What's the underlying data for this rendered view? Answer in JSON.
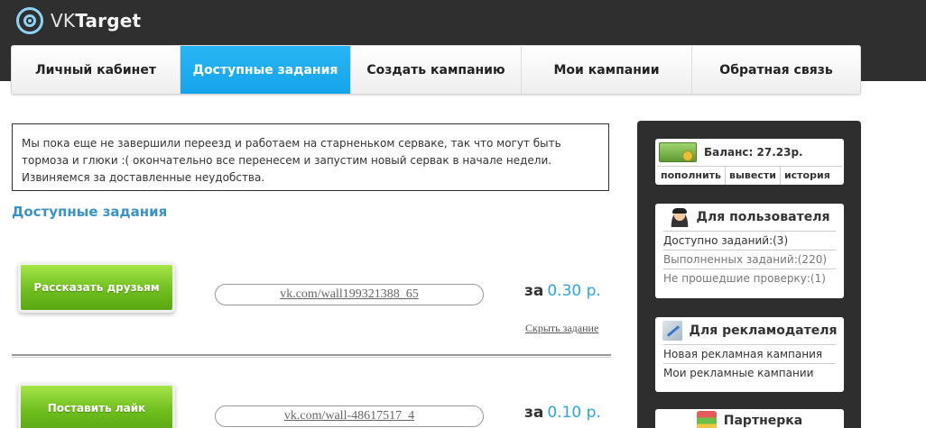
{
  "header": {
    "logo_prefix": "VK",
    "logo_suffix": "Target"
  },
  "nav": [
    {
      "label": "Личный кабинет",
      "active": false
    },
    {
      "label": "Доступные задания",
      "active": true
    },
    {
      "label": "Создать кампанию",
      "active": false
    },
    {
      "label": "Мои кампании",
      "active": false
    },
    {
      "label": "Обратная связь",
      "active": false
    }
  ],
  "notice": "Мы пока еще не завершили переезд и работаем на старненьком серваке, так что могут быть тормоза и глюки :( окончательно все перенесем и запустим новый сервак в начале недели. Извиняемся за доставленные неудобства.",
  "section_title": "Доступные задания",
  "tasks": [
    {
      "button": "Рассказать друзьям",
      "link": "vk.com/wall199321388_65",
      "price_prefix": "за",
      "price": "0.30 р.",
      "hide": "Скрыть задание"
    },
    {
      "button": "Поставить лайк",
      "link": "vk.com/wall-48617517_4",
      "price_prefix": "за",
      "price": "0.10 р."
    }
  ],
  "sidebar": {
    "balance": {
      "label": "Баланс: 27.23р.",
      "actions": [
        "пополнить",
        "вывести",
        "история"
      ]
    },
    "user": {
      "title": "Для пользователя",
      "rows": [
        "Доступно заданий:(3)",
        "Выполненных заданий:(220)",
        "Не прошедшие проверку:(1)"
      ]
    },
    "advertiser": {
      "title": "Для рекламодателя",
      "rows": [
        "Новая рекламная кампания",
        "Мои рекламные кампании"
      ]
    },
    "partner": {
      "title": "Партнерка"
    }
  },
  "colors": {
    "accent": "#29a8e0",
    "nav_active": "#1aa8ee",
    "button_green": "#6fbf1e",
    "header_bg": "#2f2f2f"
  }
}
